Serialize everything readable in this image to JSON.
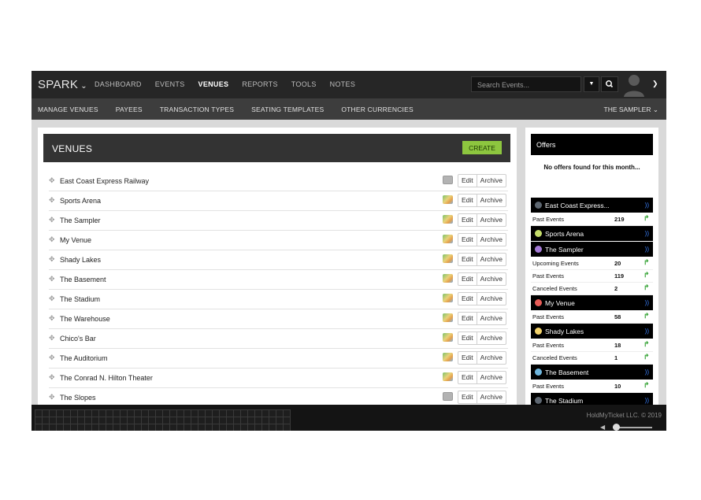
{
  "topnav": {
    "brand": "SPARK",
    "links": [
      "DASHBOARD",
      "EVENTS",
      "VENUES",
      "REPORTS",
      "TOOLS",
      "NOTES"
    ],
    "active": "VENUES",
    "search_placeholder": "Search Events..."
  },
  "subnav": {
    "links": [
      "MANAGE VENUES",
      "PAYEES",
      "TRANSACTION TYPES",
      "SEATING TEMPLATES",
      "OTHER CURRENCIES"
    ],
    "right": "THE SAMPLER"
  },
  "venues": {
    "title": "VENUES",
    "create_label": "CREATE",
    "edit_label": "Edit",
    "archive_label": "Archive",
    "items": [
      {
        "name": "East Coast Express Railway",
        "map": false
      },
      {
        "name": "Sports Arena",
        "map": true
      },
      {
        "name": "The Sampler",
        "map": true
      },
      {
        "name": "My Venue",
        "map": true
      },
      {
        "name": "Shady Lakes",
        "map": true
      },
      {
        "name": "The Basement",
        "map": true
      },
      {
        "name": "The Stadium",
        "map": true
      },
      {
        "name": "The Warehouse",
        "map": true
      },
      {
        "name": "Chico's Bar",
        "map": true
      },
      {
        "name": "The Auditorium",
        "map": true
      },
      {
        "name": "The Conrad N. Hilton Theater",
        "map": true
      },
      {
        "name": "The Slopes",
        "map": false
      }
    ]
  },
  "sidebar": {
    "offers_title": "Offers",
    "no_offers": "No offers found for this month...",
    "rows": [
      {
        "type": "venue",
        "name": "East Coast Express...",
        "color": "#5d6670"
      },
      {
        "type": "stat",
        "label": "Past Events",
        "count": "219"
      },
      {
        "type": "venue",
        "name": "Sports Arena",
        "color": "#c5dd6a"
      },
      {
        "type": "venue",
        "name": "The Sampler",
        "color": "#a57bd6"
      },
      {
        "type": "stat",
        "label": "Upcoming Events",
        "count": "20"
      },
      {
        "type": "stat",
        "label": "Past Events",
        "count": "119"
      },
      {
        "type": "stat",
        "label": "Canceled Events",
        "count": "2"
      },
      {
        "type": "venue",
        "name": "My Venue",
        "color": "#e85c57"
      },
      {
        "type": "stat",
        "label": "Past Events",
        "count": "58"
      },
      {
        "type": "venue",
        "name": "Shady Lakes",
        "color": "#f3d36b"
      },
      {
        "type": "stat",
        "label": "Past Events",
        "count": "18"
      },
      {
        "type": "stat",
        "label": "Canceled Events",
        "count": "1"
      },
      {
        "type": "venue",
        "name": "The Basement",
        "color": "#6fb6dd"
      },
      {
        "type": "stat",
        "label": "Past Events",
        "count": "10"
      },
      {
        "type": "venue",
        "name": "The Stadium",
        "color": "#5d6670"
      }
    ]
  },
  "footer": {
    "copyright": "HoldMyTicket LLC. © 2019"
  },
  "colors": {
    "accent_green": "#8dc63f",
    "nav_bg": "#262626",
    "rss_blue": "#3b82ff"
  }
}
